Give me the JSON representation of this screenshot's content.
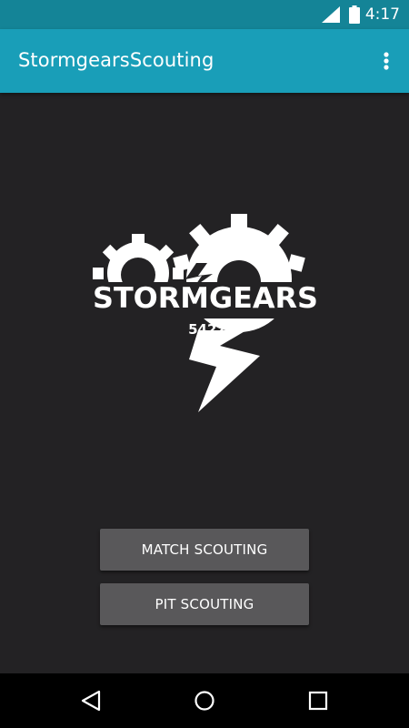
{
  "status_bar": {
    "time": "4:17",
    "icons": [
      "cell-signal-icon",
      "battery-icon"
    ]
  },
  "app_bar": {
    "title": "StormgearsScouting",
    "overflow_icon": "more-vert-icon",
    "color": "#199eb8"
  },
  "logo": {
    "wordmark": "STORMGEARS",
    "team_number": "5422"
  },
  "buttons": {
    "match_scouting": "MATCH SCOUTING",
    "pit_scouting": "PIT SCOUTING"
  },
  "nav_bar": {
    "icons": [
      "back-icon",
      "home-icon",
      "recents-icon"
    ]
  },
  "colors": {
    "status_bar": "#148497",
    "background": "#232224",
    "button": "#59585a"
  }
}
